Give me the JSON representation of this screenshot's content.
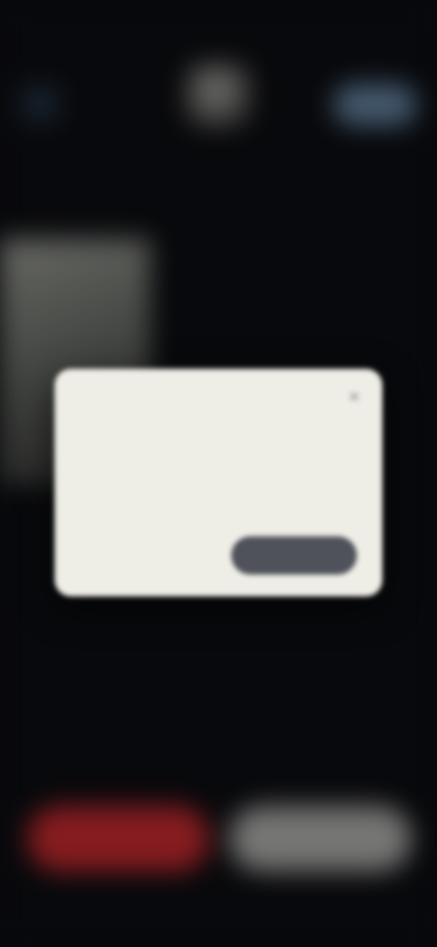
{
  "status_bar": {
    "time": ""
  },
  "header": {
    "back_icon": "arrow-left-icon",
    "logo_icon": "rock-hand-icon",
    "logo_caption": "",
    "action_label": ""
  },
  "dialog": {
    "title": "",
    "body": "",
    "secondary_label": "",
    "primary_label": "",
    "close_icon": "close-icon"
  },
  "bottom": {
    "red_label": "",
    "grey_label": ""
  },
  "colors": {
    "background": "#0b0c10",
    "accent_blue": "#5c7893",
    "danger_red": "#b3262a",
    "neutral_grey": "#9d9d9b",
    "dialog_bg": "#eeede6",
    "dialog_button": "#4f525a"
  }
}
